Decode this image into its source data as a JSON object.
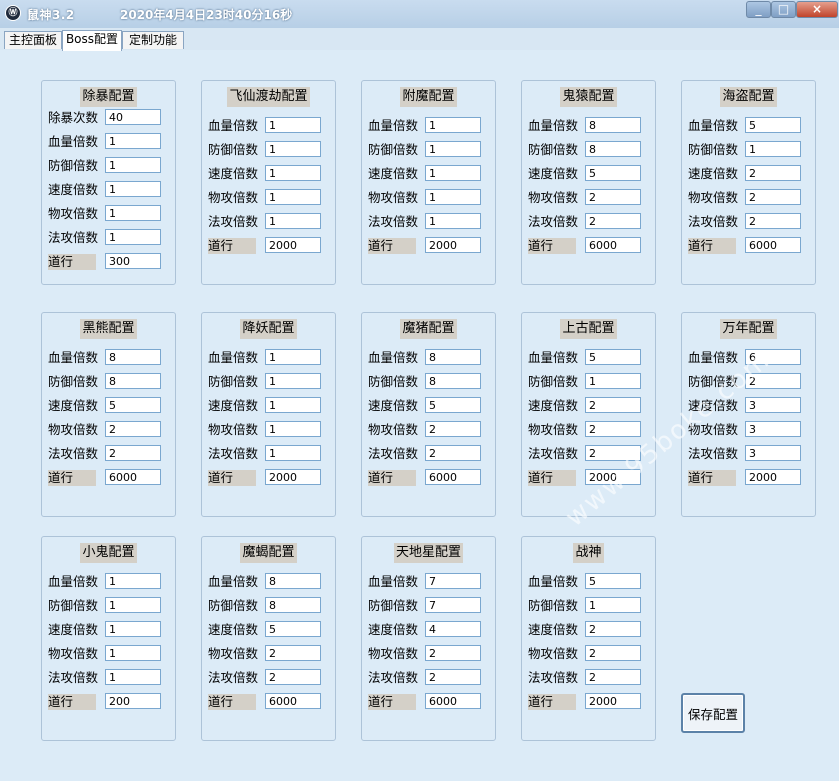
{
  "window": {
    "app_icon": "Ⓦ",
    "title": "鼠神3.2",
    "clock": "2020年4月4日23时40分16秒",
    "minimize": "_",
    "maximize": "□",
    "close": "×"
  },
  "tabs": [
    {
      "label": "主控面板"
    },
    {
      "label": "Boss配置"
    },
    {
      "label": "定制功能"
    }
  ],
  "groups": [
    {
      "title": "除暴配置",
      "rows": [
        {
          "label": "除暴次数",
          "value": "40"
        },
        {
          "label": "血量倍数",
          "value": "1"
        },
        {
          "label": "防御倍数",
          "value": "1"
        },
        {
          "label": "速度倍数",
          "value": "1"
        },
        {
          "label": "物攻倍数",
          "value": "1"
        },
        {
          "label": "法攻倍数",
          "value": "1"
        },
        {
          "label": "道行",
          "value": "300"
        }
      ]
    },
    {
      "title": "飞仙渡劫配置",
      "rows": [
        {
          "label": "血量倍数",
          "value": "1"
        },
        {
          "label": "防御倍数",
          "value": "1"
        },
        {
          "label": "速度倍数",
          "value": "1"
        },
        {
          "label": "物攻倍数",
          "value": "1"
        },
        {
          "label": "法攻倍数",
          "value": "1"
        },
        {
          "label": "道行",
          "value": "2000"
        }
      ]
    },
    {
      "title": "附魔配置",
      "rows": [
        {
          "label": "血量倍数",
          "value": "1"
        },
        {
          "label": "防御倍数",
          "value": "1"
        },
        {
          "label": "速度倍数",
          "value": "1"
        },
        {
          "label": "物攻倍数",
          "value": "1"
        },
        {
          "label": "法攻倍数",
          "value": "1"
        },
        {
          "label": "道行",
          "value": "2000"
        }
      ]
    },
    {
      "title": "鬼猿配置",
      "rows": [
        {
          "label": "血量倍数",
          "value": "8"
        },
        {
          "label": "防御倍数",
          "value": "8"
        },
        {
          "label": "速度倍数",
          "value": "5"
        },
        {
          "label": "物攻倍数",
          "value": "2"
        },
        {
          "label": "法攻倍数",
          "value": "2"
        },
        {
          "label": "道行",
          "value": "6000"
        }
      ]
    },
    {
      "title": "海盗配置",
      "rows": [
        {
          "label": "血量倍数",
          "value": "5"
        },
        {
          "label": "防御倍数",
          "value": "1"
        },
        {
          "label": "速度倍数",
          "value": "2"
        },
        {
          "label": "物攻倍数",
          "value": "2"
        },
        {
          "label": "法攻倍数",
          "value": "2"
        },
        {
          "label": "道行",
          "value": "6000"
        }
      ]
    },
    {
      "title": "黑熊配置",
      "rows": [
        {
          "label": "血量倍数",
          "value": "8"
        },
        {
          "label": "防御倍数",
          "value": "8"
        },
        {
          "label": "速度倍数",
          "value": "5"
        },
        {
          "label": "物攻倍数",
          "value": "2"
        },
        {
          "label": "法攻倍数",
          "value": "2"
        },
        {
          "label": "道行",
          "value": "6000"
        }
      ]
    },
    {
      "title": "降妖配置",
      "rows": [
        {
          "label": "血量倍数",
          "value": "1"
        },
        {
          "label": "防御倍数",
          "value": "1"
        },
        {
          "label": "速度倍数",
          "value": "1"
        },
        {
          "label": "物攻倍数",
          "value": "1"
        },
        {
          "label": "法攻倍数",
          "value": "1"
        },
        {
          "label": "道行",
          "value": "2000"
        }
      ]
    },
    {
      "title": "魔猪配置",
      "rows": [
        {
          "label": "血量倍数",
          "value": "8"
        },
        {
          "label": "防御倍数",
          "value": "8"
        },
        {
          "label": "速度倍数",
          "value": "5"
        },
        {
          "label": "物攻倍数",
          "value": "2"
        },
        {
          "label": "法攻倍数",
          "value": "2"
        },
        {
          "label": "道行",
          "value": "6000"
        }
      ]
    },
    {
      "title": "上古配置",
      "rows": [
        {
          "label": "血量倍数",
          "value": "5"
        },
        {
          "label": "防御倍数",
          "value": "1"
        },
        {
          "label": "速度倍数",
          "value": "2"
        },
        {
          "label": "物攻倍数",
          "value": "2"
        },
        {
          "label": "法攻倍数",
          "value": "2"
        },
        {
          "label": "道行",
          "value": "2000"
        }
      ]
    },
    {
      "title": "万年配置",
      "rows": [
        {
          "label": "血量倍数",
          "value": "6"
        },
        {
          "label": "防御倍数",
          "value": "2"
        },
        {
          "label": "速度倍数",
          "value": "3"
        },
        {
          "label": "物攻倍数",
          "value": "3"
        },
        {
          "label": "法攻倍数",
          "value": "3"
        },
        {
          "label": "道行",
          "value": "2000"
        }
      ]
    },
    {
      "title": "小鬼配置",
      "rows": [
        {
          "label": "血量倍数",
          "value": "1"
        },
        {
          "label": "防御倍数",
          "value": "1"
        },
        {
          "label": "速度倍数",
          "value": "1"
        },
        {
          "label": "物攻倍数",
          "value": "1"
        },
        {
          "label": "法攻倍数",
          "value": "1"
        },
        {
          "label": "道行",
          "value": "200"
        }
      ]
    },
    {
      "title": "魔蝎配置",
      "rows": [
        {
          "label": "血量倍数",
          "value": "8"
        },
        {
          "label": "防御倍数",
          "value": "8"
        },
        {
          "label": "速度倍数",
          "value": "5"
        },
        {
          "label": "物攻倍数",
          "value": "2"
        },
        {
          "label": "法攻倍数",
          "value": "2"
        },
        {
          "label": "道行",
          "value": "6000"
        }
      ]
    },
    {
      "title": "天地星配置",
      "rows": [
        {
          "label": "血量倍数",
          "value": "7"
        },
        {
          "label": "防御倍数",
          "value": "7"
        },
        {
          "label": "速度倍数",
          "value": "4"
        },
        {
          "label": "物攻倍数",
          "value": "2"
        },
        {
          "label": "法攻倍数",
          "value": "2"
        },
        {
          "label": "道行",
          "value": "6000"
        }
      ]
    },
    {
      "title": "战神",
      "rows": [
        {
          "label": "血量倍数",
          "value": "5"
        },
        {
          "label": "防御倍数",
          "value": "1"
        },
        {
          "label": "速度倍数",
          "value": "2"
        },
        {
          "label": "物攻倍数",
          "value": "2"
        },
        {
          "label": "法攻倍数",
          "value": "2"
        },
        {
          "label": "道行",
          "value": "2000"
        }
      ]
    }
  ],
  "save_button": "保存配置",
  "watermark": "www.95boke.com"
}
